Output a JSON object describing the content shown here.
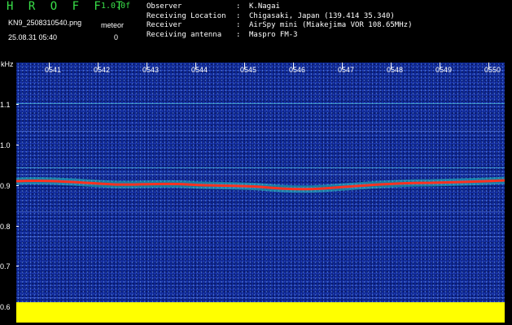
{
  "header": {
    "app_title": "H R O F F T",
    "version": "1.0.0f",
    "file_name": "KN9_2508310540.png",
    "meteor_label": "meteor",
    "datetime": "25.08.31 05:40",
    "meteor_count": "0",
    "info": [
      {
        "key": "Observer",
        "value": "K.Nagai"
      },
      {
        "key": "Receiving Location",
        "value": "Chigasaki, Japan (139.414 35.340)"
      },
      {
        "key": "Receiver",
        "value": "AirSpy mini (Miakejima VOR 108.65MHz)"
      },
      {
        "key": "Receiving antenna",
        "value": "Maspro FM-3"
      }
    ]
  },
  "axis": {
    "unit": "kHz",
    "y_labels": [
      "1.1",
      "1.0",
      "0.9",
      "0.8",
      "0.7",
      "0.6"
    ],
    "time_labels": [
      "0541",
      "0542",
      "0543",
      "0544",
      "0545",
      "0546",
      "0547",
      "0548",
      "0549",
      "0550"
    ]
  },
  "colors": {
    "header_green": "#39e049",
    "background_blue": "#0c2691",
    "signal_red": "#ff3020",
    "baseline_yellow": "#ffff00"
  }
}
